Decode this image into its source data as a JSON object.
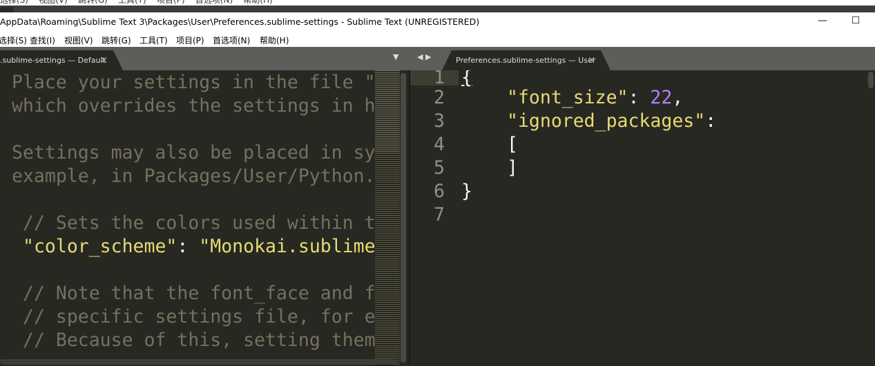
{
  "window": {
    "title": "AppData\\Roaming\\Sublime Text 3\\Packages\\User\\Preferences.sublime-settings - Sublime Text (UNREGISTERED)",
    "minimize": "—",
    "maximize": "☐"
  },
  "background_menu": "选择(S)    视图(V)    跳转(G)    工具(T)    项目(P)    首选项(N)    帮助(H)",
  "menu": [
    "选择(S)",
    "查找(I)",
    "视图(V)",
    "跳转(G)",
    "工具(T)",
    "项目(P)",
    "首选项(N)",
    "帮助(H)"
  ],
  "tabs": {
    "left": {
      "label": ".sublime-settings — Default",
      "close": "×"
    },
    "right": {
      "label": "Preferences.sublime-settings — User",
      "close": "×"
    },
    "dropdown": "▼",
    "nav": "◀ ▶"
  },
  "left_code": [
    "Place your settings in the file \"",
    "which overrides the settings in h",
    "Settings may also be placed in sy",
    "example, in Packages/User/Python.",
    "// Sets the colors used within t",
    "\"color_scheme\"",
    ": ",
    "\"Monokai.sublime",
    "// Note that the font_face and f",
    "// specific settings file, for e",
    "// Because of this, setting them"
  ],
  "right_code": {
    "line_numbers": [
      "1",
      "2",
      "3",
      "4",
      "5",
      "6",
      "7"
    ],
    "open_brace": "{",
    "key1": "\"font_size\"",
    "colon": ": ",
    "val1": "22",
    "comma": ",",
    "key2": "\"ignored_packages\"",
    "colon2": ":",
    "lbr": "[",
    "rbr": "]",
    "close_brace": "}"
  },
  "colors": {
    "background": "#272822",
    "comment": "#75715e",
    "string": "#e6db74",
    "number": "#ae81ff",
    "text": "#f8f8f2"
  }
}
